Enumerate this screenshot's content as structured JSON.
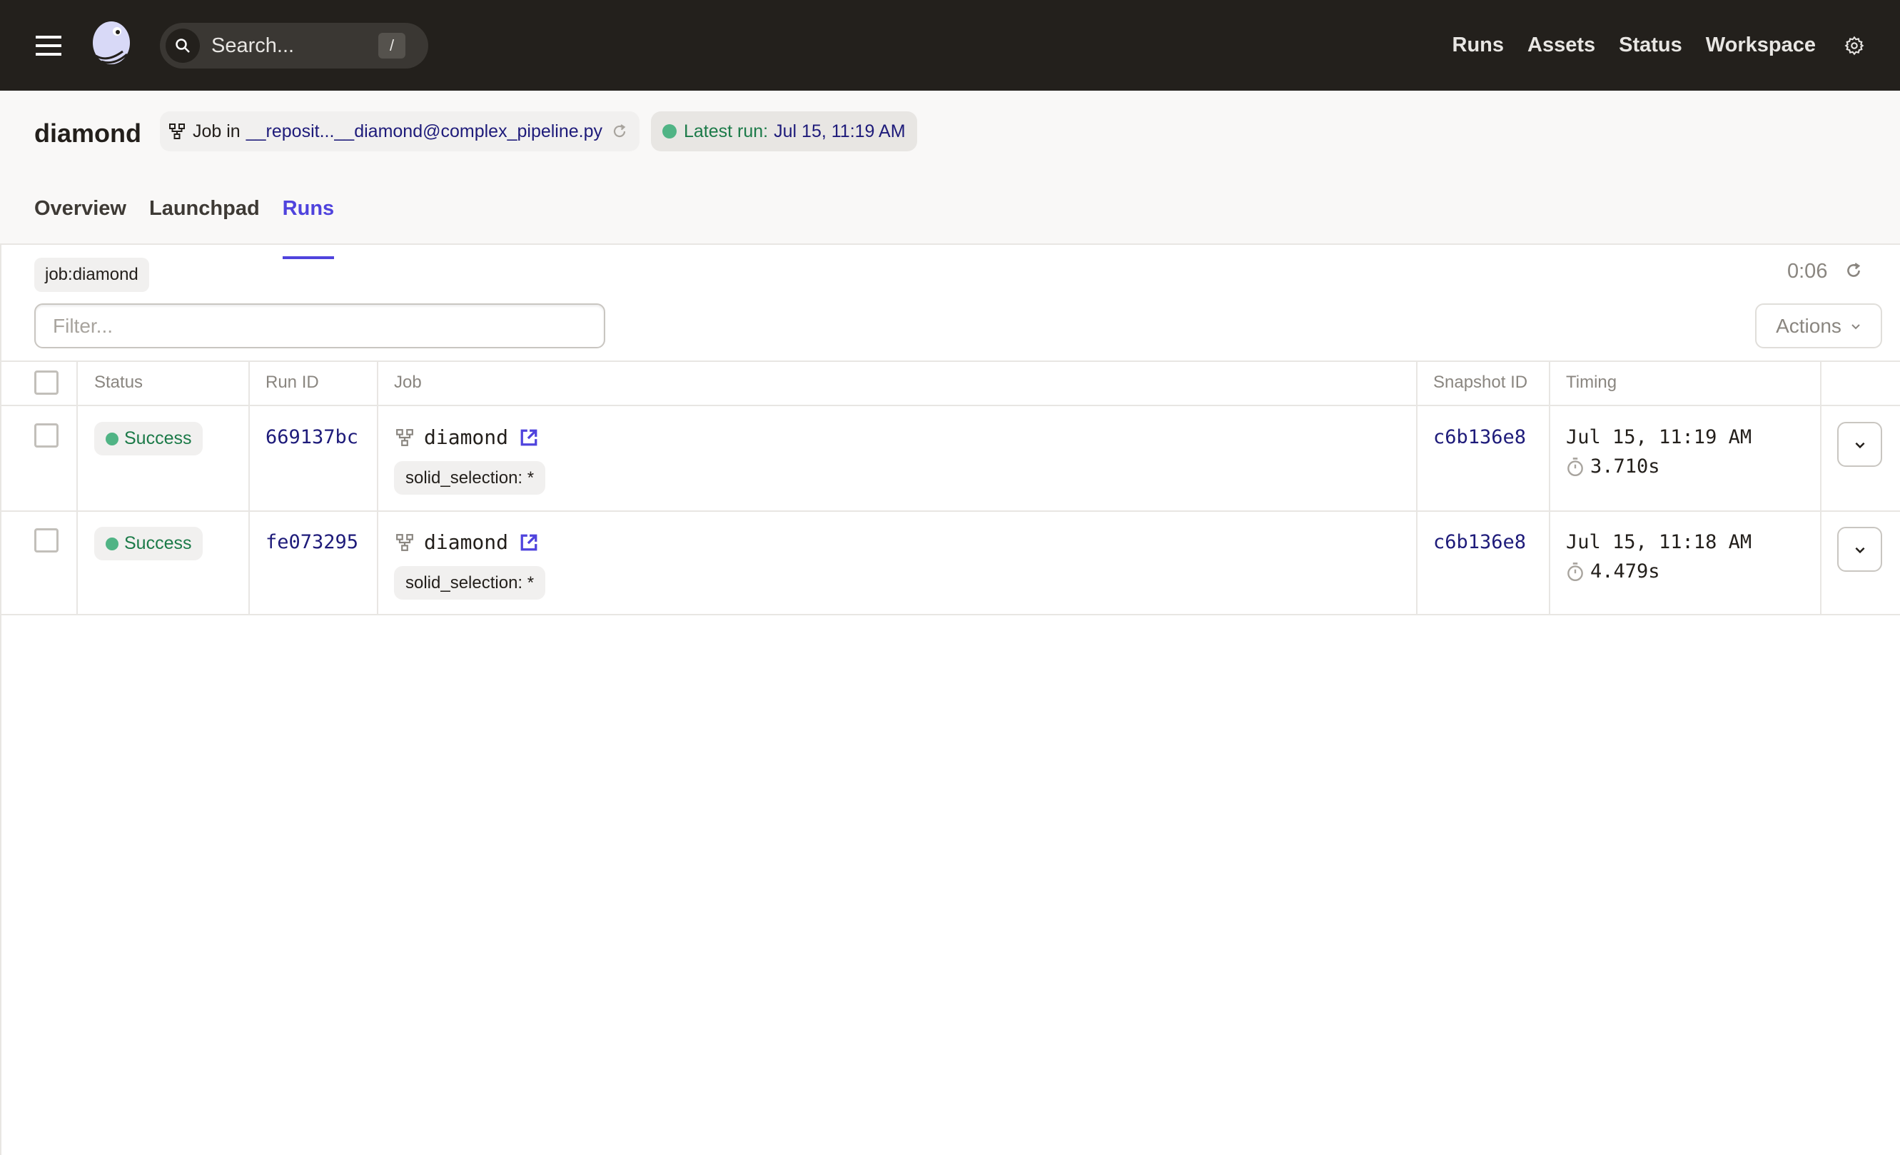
{
  "topbar": {
    "search_placeholder": "Search...",
    "search_shortcut": "/",
    "nav": [
      {
        "label": "Runs"
      },
      {
        "label": "Assets"
      },
      {
        "label": "Status"
      },
      {
        "label": "Workspace"
      }
    ]
  },
  "header": {
    "title": "diamond",
    "job_prefix": "Job in",
    "repo_link": "__reposit...__diamond@complex_pipeline.py",
    "latest_run_label": "Latest run:",
    "latest_run_time": "Jul 15, 11:19 AM",
    "tabs": [
      {
        "label": "Overview",
        "active": false
      },
      {
        "label": "Launchpad",
        "active": false
      },
      {
        "label": "Runs",
        "active": true
      }
    ]
  },
  "filters": {
    "tag": "job:diamond",
    "refresh_countdown": "0:06",
    "filter_placeholder": "Filter...",
    "filter_value": "",
    "actions_label": "Actions"
  },
  "table": {
    "columns": [
      "Status",
      "Run ID",
      "Job",
      "Snapshot ID",
      "Timing"
    ],
    "rows": [
      {
        "status": "Success",
        "run_id": "669137bc",
        "job": "diamond",
        "tag": "solid_selection: *",
        "snapshot_id": "c6b136e8",
        "start_time": "Jul 15, 11:19 AM",
        "duration": "3.710s"
      },
      {
        "status": "Success",
        "run_id": "fe073295",
        "job": "diamond",
        "tag": "solid_selection: *",
        "snapshot_id": "c6b136e8",
        "start_time": "Jul 15, 11:18 AM",
        "duration": "4.479s"
      }
    ]
  },
  "colors": {
    "topbar_bg": "#23201c",
    "accent": "#4f43dd",
    "success": "#50b485",
    "link": "#1e1b7a"
  }
}
